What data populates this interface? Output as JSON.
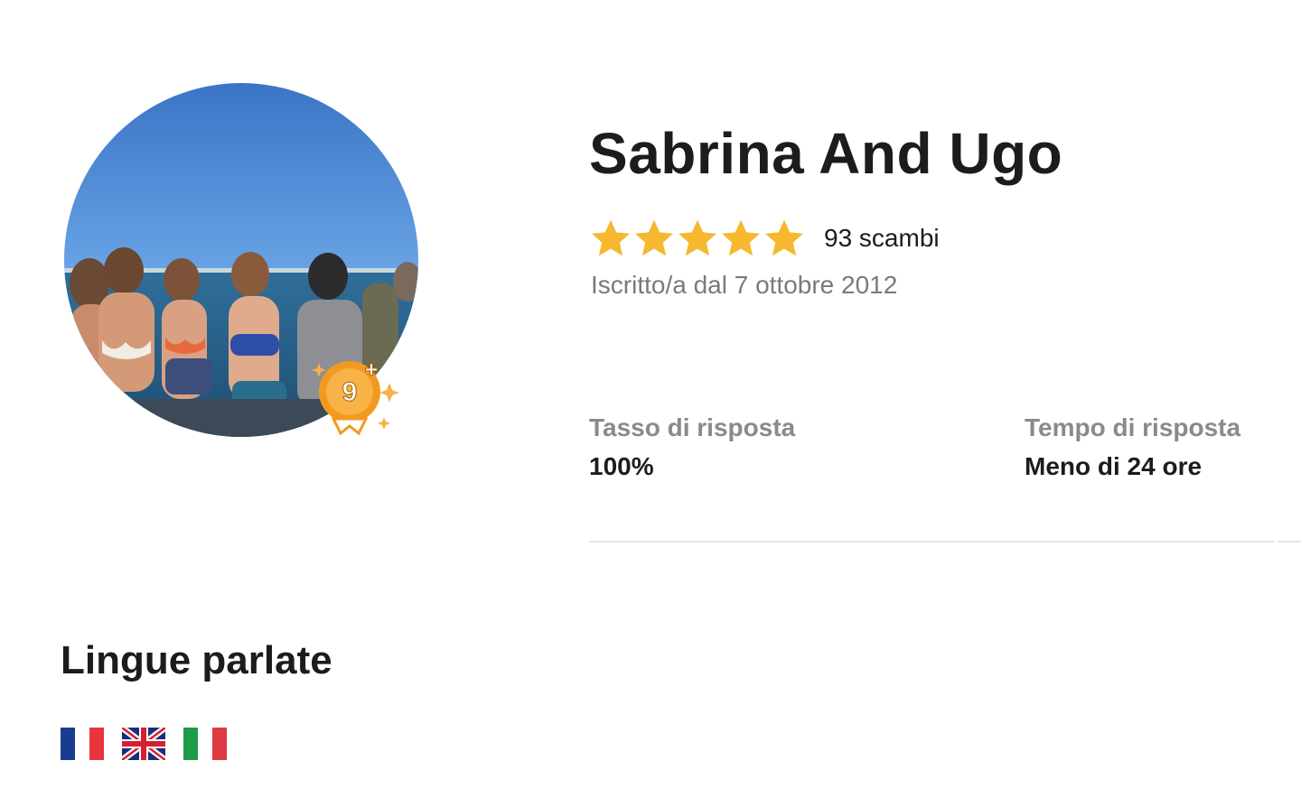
{
  "profile": {
    "name": "Sabrina And Ugo",
    "rating_stars": 5,
    "exchanges_label": "93 scambi",
    "member_since": "Iscritto/a dal 7 ottobre 2012",
    "badge_label": "9+",
    "avatar_icon": "profile-photo"
  },
  "stats": {
    "response_rate": {
      "label": "Tasso di risposta",
      "value": "100%"
    },
    "response_time": {
      "label": "Tempo di risposta",
      "value": "Meno di 24 ore"
    }
  },
  "languages": {
    "title": "Lingue parlate",
    "flags": [
      "france-flag-icon",
      "uk-flag-icon",
      "italy-flag-icon"
    ]
  },
  "colors": {
    "star": "#f5b82e",
    "badge": "#f29a1f",
    "text": "#1c1c1c",
    "muted": "#7a7a7a"
  }
}
